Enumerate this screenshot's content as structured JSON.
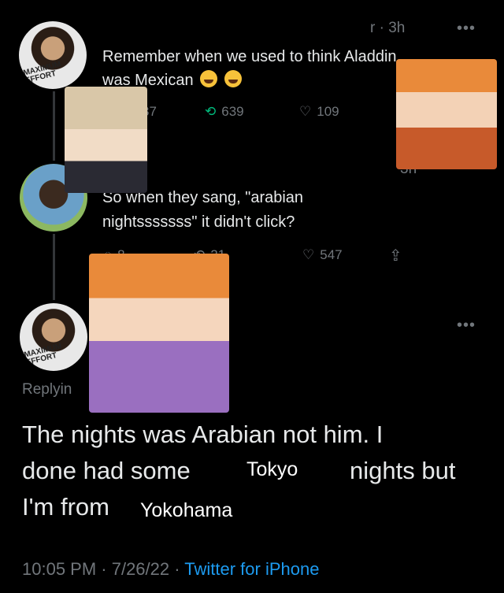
{
  "tweet1": {
    "handle_time": "r · 3h",
    "more": "•••",
    "text_line1": "Remember when we used to think Aladdin",
    "text_line2": "was Mexican",
    "emoji_icon": "rolling-on-floor-laughing-icon",
    "reply_count": "37",
    "retweet_count": "639",
    "like_count": "109"
  },
  "tweet2": {
    "time": "3h",
    "text_line1": "So when they sang, \"arabian",
    "text_line2": "nightsssssss\" it didn't click?",
    "reply_count": "8",
    "retweet_count": "21",
    "like_count": "547"
  },
  "tweet3": {
    "more": "•••",
    "handle_partial": "@",
    "replying": "Replyin",
    "line1": "The nights was Arabian not him. I",
    "line2_a": "done had some",
    "line2_b": "nights but",
    "line3_a": "I'm from",
    "footer_time": "10:05 PM · 7/26/22 · ",
    "footer_source": "Twitter for iPhone"
  },
  "overlays": {
    "label1": "Tokyo",
    "label2": "Yokohama"
  },
  "avatar_texts": {
    "av1": "MAXIMUM EFFORT",
    "av3": "MAXIMUM EFFORT"
  },
  "colors": {
    "background": "#000000",
    "text": "#e7e9ea",
    "muted": "#71767b",
    "link": "#1d9bf0"
  }
}
